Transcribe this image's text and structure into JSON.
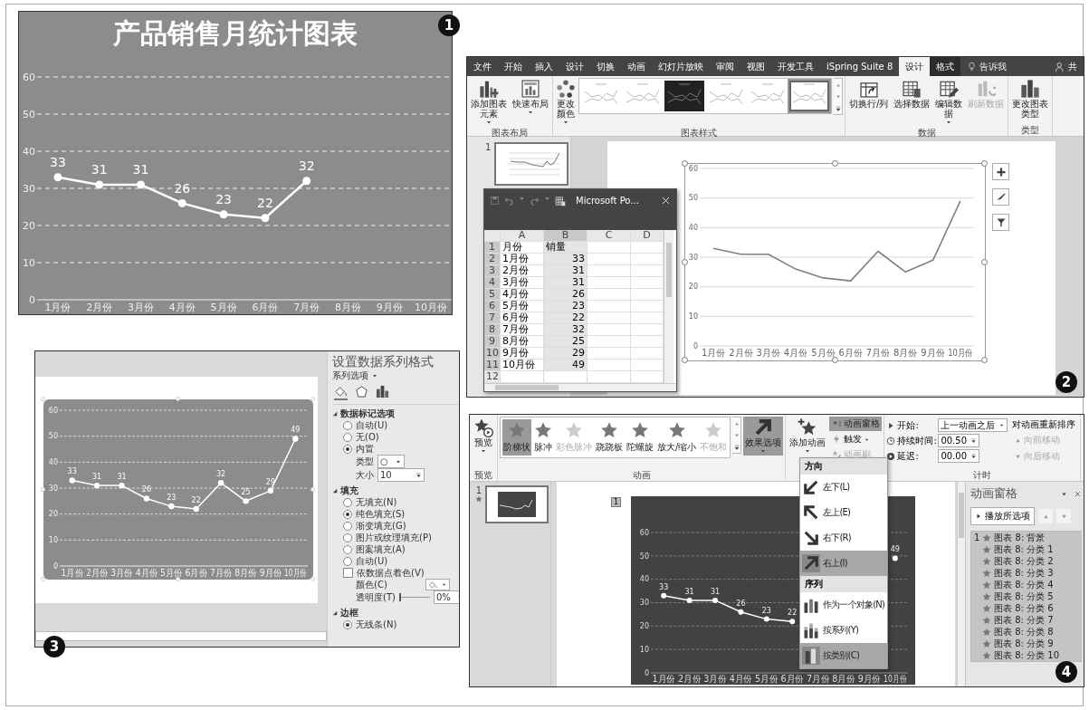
{
  "chart_preview": {
    "badge": "1",
    "chart_data": {
      "type": "line",
      "title": "产品销售月统计图表",
      "categories": [
        "1月份",
        "2月份",
        "3月份",
        "4月份",
        "5月份",
        "6月份",
        "7月份",
        "8月份",
        "9月份",
        "10月份"
      ],
      "series": [
        {
          "color": "#ffffff",
          "marker": "circle",
          "values": [
            33,
            31,
            31,
            26,
            23,
            22,
            32,
            null,
            null,
            null
          ]
        }
      ],
      "ylim": [
        0,
        60
      ],
      "yticks": [
        0,
        10,
        20,
        30,
        40,
        50,
        60
      ],
      "grid": true,
      "data_labels": true
    }
  },
  "design_screen": {
    "badge": "2",
    "tabs": [
      {
        "label": "文件",
        "selected": false,
        "contextual": false
      },
      {
        "label": "开始",
        "selected": false,
        "contextual": false
      },
      {
        "label": "插入",
        "selected": false,
        "contextual": false
      },
      {
        "label": "设计",
        "selected": false,
        "contextual": false
      },
      {
        "label": "切换",
        "selected": false,
        "contextual": false
      },
      {
        "label": "动画",
        "selected": false,
        "contextual": false
      },
      {
        "label": "幻灯片放映",
        "selected": false,
        "contextual": false
      },
      {
        "label": "审阅",
        "selected": false,
        "contextual": false
      },
      {
        "label": "视图",
        "selected": false,
        "contextual": false
      },
      {
        "label": "开发工具",
        "selected": false,
        "contextual": false
      },
      {
        "label": "iSpring Suite 8",
        "selected": false,
        "contextual": false
      },
      {
        "label": "设计",
        "selected": true,
        "contextual": true
      },
      {
        "label": "格式",
        "selected": false,
        "contextual": true
      }
    ],
    "tell_me": "告诉我",
    "account": "共",
    "ribbon_groups": [
      {
        "label": "图表布局",
        "items": [
          {
            "kind": "button",
            "label": "添加图表元素",
            "dropdown": true,
            "disabled": false
          },
          {
            "kind": "button",
            "label": "快速布局",
            "dropdown": true,
            "disabled": false
          }
        ]
      },
      {
        "label": "图表样式",
        "items": [
          {
            "kind": "button",
            "label": "更改颜色",
            "dropdown": true,
            "disabled": false
          },
          {
            "kind": "gallery",
            "styles": [
              {
                "dark": false,
                "selected": false
              },
              {
                "dark": false,
                "selected": false
              },
              {
                "dark": true,
                "selected": false
              },
              {
                "dark": false,
                "selected": false
              },
              {
                "dark": false,
                "selected": false
              },
              {
                "dark": false,
                "selected": true
              }
            ]
          }
        ]
      },
      {
        "label": "数据",
        "items": [
          {
            "kind": "button",
            "label": "切换行/列",
            "dropdown": false,
            "disabled": false
          },
          {
            "kind": "button",
            "label": "选择数据",
            "dropdown": false,
            "disabled": false
          },
          {
            "kind": "button",
            "label": "编辑数据",
            "dropdown": true,
            "disabled": false
          },
          {
            "kind": "button",
            "label": "刷新数据",
            "dropdown": false,
            "disabled": true
          }
        ]
      },
      {
        "label": "类型",
        "items": [
          {
            "kind": "button",
            "label": "更改图表类型",
            "dropdown": false,
            "disabled": false
          }
        ]
      }
    ],
    "slides": [
      {
        "number": "1",
        "selected": true
      }
    ],
    "sheet": {
      "title": "Microsoft Po...",
      "columns": [
        {
          "label": "A",
          "selected": false
        },
        {
          "label": "B",
          "selected": true
        },
        {
          "label": "C",
          "selected": false
        },
        {
          "label": "D",
          "selected": false
        }
      ],
      "rows": [
        {
          "number": "1",
          "selected": true,
          "cells": [
            "月份",
            "销量"
          ]
        },
        {
          "number": "2",
          "selected": true,
          "cells": [
            "1月份",
            "33"
          ]
        },
        {
          "number": "3",
          "selected": true,
          "cells": [
            "2月份",
            "31"
          ]
        },
        {
          "number": "4",
          "selected": true,
          "cells": [
            "3月份",
            "31"
          ]
        },
        {
          "number": "5",
          "selected": true,
          "cells": [
            "4月份",
            "26"
          ]
        },
        {
          "number": "6",
          "selected": true,
          "cells": [
            "5月份",
            "23"
          ]
        },
        {
          "number": "7",
          "selected": true,
          "cells": [
            "6月份",
            "22"
          ]
        },
        {
          "number": "8",
          "selected": true,
          "cells": [
            "7月份",
            "32"
          ]
        },
        {
          "number": "9",
          "selected": true,
          "cells": [
            "8月份",
            "25"
          ]
        },
        {
          "number": "10",
          "selected": true,
          "cells": [
            "9月份",
            "29"
          ]
        },
        {
          "number": "11",
          "selected": true,
          "cells": [
            "10月份",
            "49"
          ]
        },
        {
          "number": "12",
          "selected": false,
          "cells": []
        }
      ]
    },
    "chart_data": {
      "type": "line",
      "categories": [
        "1月份",
        "2月份",
        "3月份",
        "4月份",
        "5月份",
        "6月份",
        "7月份",
        "8月份",
        "9月份",
        "10月份"
      ],
      "series": [
        {
          "color": "#808080",
          "values": [
            33,
            31,
            31,
            26,
            23,
            22,
            32,
            25,
            29,
            49
          ]
        }
      ],
      "ylim": [
        0,
        60
      ],
      "yticks": [
        0,
        10,
        20,
        30,
        40,
        50,
        60
      ],
      "grid": true
    }
  },
  "format_screen": {
    "badge": "3",
    "chart_data": {
      "type": "line",
      "categories": [
        "1月份",
        "2月份",
        "3月份",
        "4月份",
        "5月份",
        "6月份",
        "7月份",
        "8月份",
        "9月份",
        "10月份"
      ],
      "series": [
        {
          "color": "#ffffff",
          "marker": "circle",
          "values": [
            33,
            31,
            31,
            26,
            23,
            22,
            32,
            25,
            29,
            49
          ]
        }
      ],
      "ylim": [
        0,
        60
      ],
      "yticks": [
        0,
        10,
        20,
        30,
        40,
        50,
        60
      ],
      "grid": true,
      "data_labels": true
    },
    "pane": {
      "title": "设置数据系列格式",
      "subtitle": "系列选项",
      "tabs": [
        {
          "selected": true
        },
        {
          "selected": false
        },
        {
          "selected": false
        }
      ],
      "sections": [
        {
          "label": "数据标记选项",
          "expanded": true,
          "items": [
            {
              "kind": "radio",
              "label": "自动(U)",
              "selected": false
            },
            {
              "kind": "radio",
              "label": "无(O)",
              "selected": false
            },
            {
              "kind": "radio",
              "label": "内置",
              "selected": true
            },
            {
              "kind": "dropdown",
              "label": "类型",
              "value": "○"
            },
            {
              "kind": "spinner",
              "label": "大小",
              "value": "10"
            }
          ]
        },
        {
          "label": "填充",
          "expanded": true,
          "items": [
            {
              "kind": "radio",
              "label": "无填充(N)",
              "selected": false
            },
            {
              "kind": "radio",
              "label": "纯色填充(S)",
              "selected": true
            },
            {
              "kind": "radio",
              "label": "渐变填充(G)",
              "selected": false
            },
            {
              "kind": "radio",
              "label": "图片或纹理填充(P)",
              "selected": false
            },
            {
              "kind": "radio",
              "label": "图案填充(A)",
              "selected": false
            },
            {
              "kind": "radio",
              "label": "自动(U)",
              "selected": false
            },
            {
              "kind": "checkbox",
              "label": "依数据点着色(V)",
              "checked": false
            },
            {
              "kind": "color",
              "label": "颜色(C)"
            },
            {
              "kind": "slider",
              "label": "透明度(T)",
              "level": 0,
              "value": "0%"
            }
          ]
        },
        {
          "label": "边框",
          "expanded": true,
          "items": [
            {
              "kind": "radio",
              "label": "无线条(N)",
              "selected": true
            }
          ]
        }
      ]
    }
  },
  "animation_screen": {
    "badge": "4",
    "ribbon": {
      "preview": {
        "label": "预览",
        "group_label": "预览"
      },
      "effects": [
        {
          "label": "阶梯状",
          "selected": true,
          "disabled": false
        },
        {
          "label": "脉冲",
          "selected": false,
          "disabled": false
        },
        {
          "label": "彩色脉冲",
          "selected": false,
          "disabled": true
        },
        {
          "label": "跷跷板",
          "selected": false,
          "disabled": false
        },
        {
          "label": "陀螺旋",
          "selected": false,
          "disabled": false
        },
        {
          "label": "放大/缩小",
          "selected": false,
          "disabled": false
        },
        {
          "label": "不饱和",
          "selected": false,
          "disabled": true
        }
      ],
      "effect_options": {
        "label": "效果选项",
        "pressed": true
      },
      "animation_group_label": "动画",
      "add_animation": {
        "label": "添加动画"
      },
      "tools": [
        {
          "label": "动画窗格",
          "pressed": true,
          "disabled": false,
          "dropdown": false
        },
        {
          "label": "触发",
          "pressed": false,
          "disabled": false,
          "dropdown": true
        },
        {
          "label": "动画刷",
          "pressed": false,
          "disabled": true,
          "dropdown": false
        }
      ],
      "timing": {
        "start": {
          "label": "开始:",
          "value": "上一动画之后"
        },
        "duration": {
          "label": "持续时间:",
          "value": "00.50"
        },
        "delay": {
          "label": "延迟:",
          "value": "00.00"
        },
        "reorder_title": "对动画重新排序",
        "reorder": [
          {
            "label": "向前移动",
            "disabled": true
          },
          {
            "label": "向后移动",
            "disabled": true
          }
        ],
        "group_label": "计时"
      }
    },
    "menu": {
      "sections": [
        {
          "header": "方向",
          "items": [
            {
              "label": "左下(L)",
              "selected": false
            },
            {
              "label": "左上(E)",
              "selected": false
            },
            {
              "label": "右下(R)",
              "selected": false
            },
            {
              "label": "右上(I)",
              "selected": true
            }
          ]
        },
        {
          "header": "序列",
          "items": [
            {
              "label": "作为一个对象(N)",
              "selected": false
            },
            {
              "label": "按系列(Y)",
              "selected": false
            },
            {
              "label": "按类别(C)",
              "selected": true
            }
          ]
        }
      ]
    },
    "slides": [
      {
        "number": "1",
        "animated": true,
        "selected": true
      }
    ],
    "chart": {
      "order_tag": "1",
      "chart_data": {
        "type": "line",
        "categories": [
          "1月份",
          "2月份",
          "3月份",
          "4月份",
          "5月份",
          "6月份",
          "7月份",
          "8月份",
          "9月份",
          "10月份"
        ],
        "series": [
          {
            "color": "#ffffff",
            "marker": "circle",
            "values": [
              33,
              31,
              31,
              26,
              23,
              22,
              null,
              null,
              null,
              49
            ]
          }
        ],
        "ylim": [
          0,
          60
        ],
        "yticks": [
          0,
          10,
          20,
          30,
          40,
          50,
          60
        ],
        "grid": true,
        "data_labels": true
      }
    },
    "pane": {
      "title": "动画窗格",
      "play_label": "播放所选项",
      "items": [
        {
          "number": "1",
          "label": "图表 8: 背景",
          "selected": true
        },
        {
          "label": "图表 8: 分类 1",
          "selected": true
        },
        {
          "label": "图表 8: 分类 2",
          "selected": true
        },
        {
          "label": "图表 8: 分类 3",
          "selected": true
        },
        {
          "label": "图表 8: 分类 4",
          "selected": true
        },
        {
          "label": "图表 8: 分类 5",
          "selected": true
        },
        {
          "label": "图表 8: 分类 6",
          "selected": true
        },
        {
          "label": "图表 8: 分类 7",
          "selected": true
        },
        {
          "label": "图表 8: 分类 8",
          "selected": true
        },
        {
          "label": "图表 8: 分类 9",
          "selected": true
        },
        {
          "label": "图表 8: 分类 10",
          "selected": true
        }
      ]
    }
  }
}
